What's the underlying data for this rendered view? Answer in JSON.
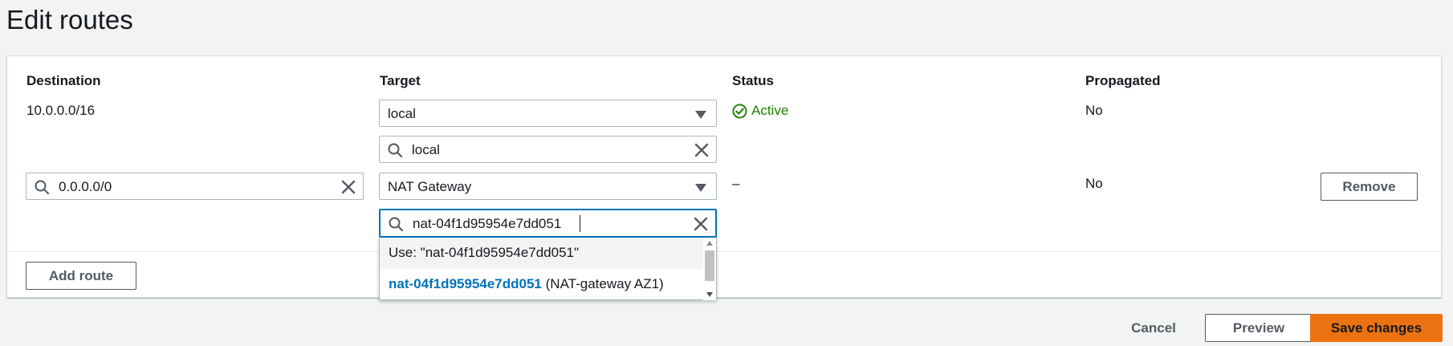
{
  "page": {
    "title": "Edit routes"
  },
  "table": {
    "headers": {
      "destination": "Destination",
      "target": "Target",
      "status": "Status",
      "propagated": "Propagated"
    },
    "rows": [
      {
        "destination": "10.0.0.0/16",
        "target_select": "local",
        "target_search": "local",
        "status": "Active",
        "propagated": "No"
      },
      {
        "destination_input": "0.0.0.0/0",
        "target_select": "NAT Gateway",
        "target_search": "nat-04f1d95954e7dd051",
        "status": "–",
        "propagated": "No",
        "remove_label": "Remove"
      }
    ]
  },
  "dropdown": {
    "use_option": "Use: \"nat-04f1d95954e7dd051\"",
    "match_id": "nat-04f1d95954e7dd051",
    "match_name": "(NAT-gateway AZ1)"
  },
  "buttons": {
    "add_route": "Add route",
    "cancel": "Cancel",
    "preview": "Preview",
    "save": "Save changes"
  },
  "icons": {
    "search": "search-icon",
    "clear": "clear-icon",
    "caret": "caret-down-icon",
    "status_ok": "check-circle-icon"
  },
  "colors": {
    "accent": "#ec7211",
    "link": "#0073bb",
    "success": "#1d8102",
    "focus": "#0073bb"
  }
}
